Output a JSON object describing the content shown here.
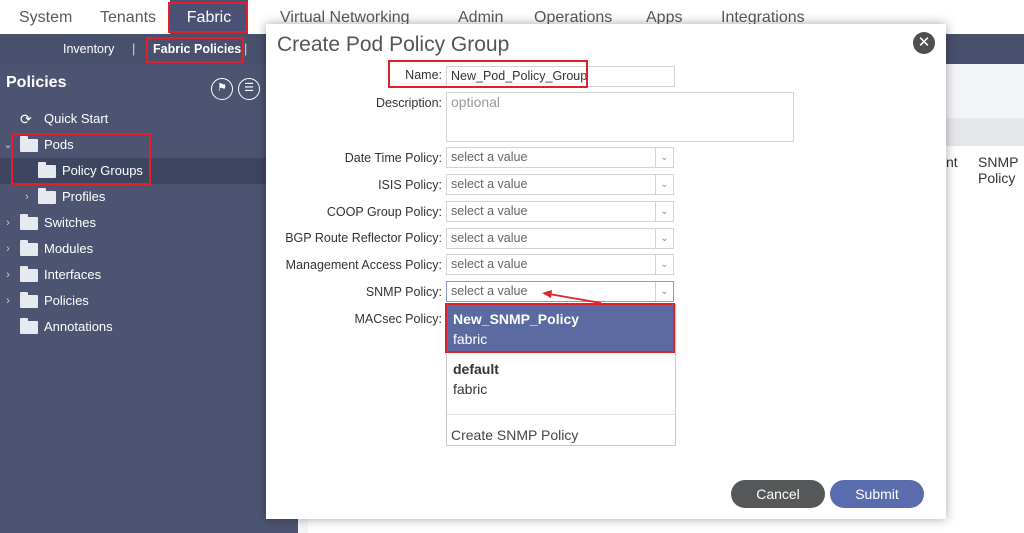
{
  "top_nav": {
    "tabs": [
      "System",
      "Tenants",
      "Fabric",
      "Virtual Networking",
      "Admin",
      "Operations",
      "Apps",
      "Integrations"
    ],
    "active": "Fabric"
  },
  "sub_nav": {
    "items": [
      "Inventory",
      "Fabric Policies"
    ],
    "active": "Fabric Policies",
    "separator": "|"
  },
  "sidebar": {
    "title": "Policies",
    "items": [
      {
        "label": "Quick Start",
        "level": 0
      },
      {
        "label": "Pods",
        "level": 0,
        "expanded": true
      },
      {
        "label": "Policy Groups",
        "level": 1,
        "selected": true
      },
      {
        "label": "Profiles",
        "level": 1
      },
      {
        "label": "Switches",
        "level": 0
      },
      {
        "label": "Modules",
        "level": 0
      },
      {
        "label": "Interfaces",
        "level": 0
      },
      {
        "label": "Policies",
        "level": 0
      },
      {
        "label": "Annotations",
        "level": 0
      }
    ]
  },
  "main": {
    "col_partial": "nt",
    "col_snmp": "SNMP\nPolicy"
  },
  "modal": {
    "title": "Create Pod Policy Group",
    "fields": {
      "name_label": "Name:",
      "name_value": "New_Pod_Policy_Group",
      "description_label": "Description:",
      "description_placeholder": "optional"
    },
    "selects": [
      {
        "label": "Date Time Policy:",
        "value": "select a value"
      },
      {
        "label": "ISIS Policy:",
        "value": "select a value"
      },
      {
        "label": "COOP Group Policy:",
        "value": "select a value"
      },
      {
        "label": "BGP Route Reflector Policy:",
        "value": "select a value"
      },
      {
        "label": "Management Access Policy:",
        "value": "select a value"
      },
      {
        "label": "SNMP Policy:",
        "value": "select a value"
      }
    ],
    "macsec_label": "MACsec Policy:",
    "dropdown": {
      "options": [
        {
          "name": "New_SNMP_Policy",
          "sub": "fabric",
          "highlighted": true
        },
        {
          "name": "default",
          "sub": "fabric",
          "highlighted": false
        }
      ],
      "create_label": "Create SNMP Policy"
    },
    "cancel_label": "Cancel",
    "submit_label": "Submit"
  },
  "colors": {
    "nav_active": "#4a5174",
    "sidebar_bg": "#4d5471",
    "highlight_red": "#e0202a",
    "option_highlight": "#5b6aa0",
    "submit": "#5a6cad",
    "cancel": "#555759"
  }
}
